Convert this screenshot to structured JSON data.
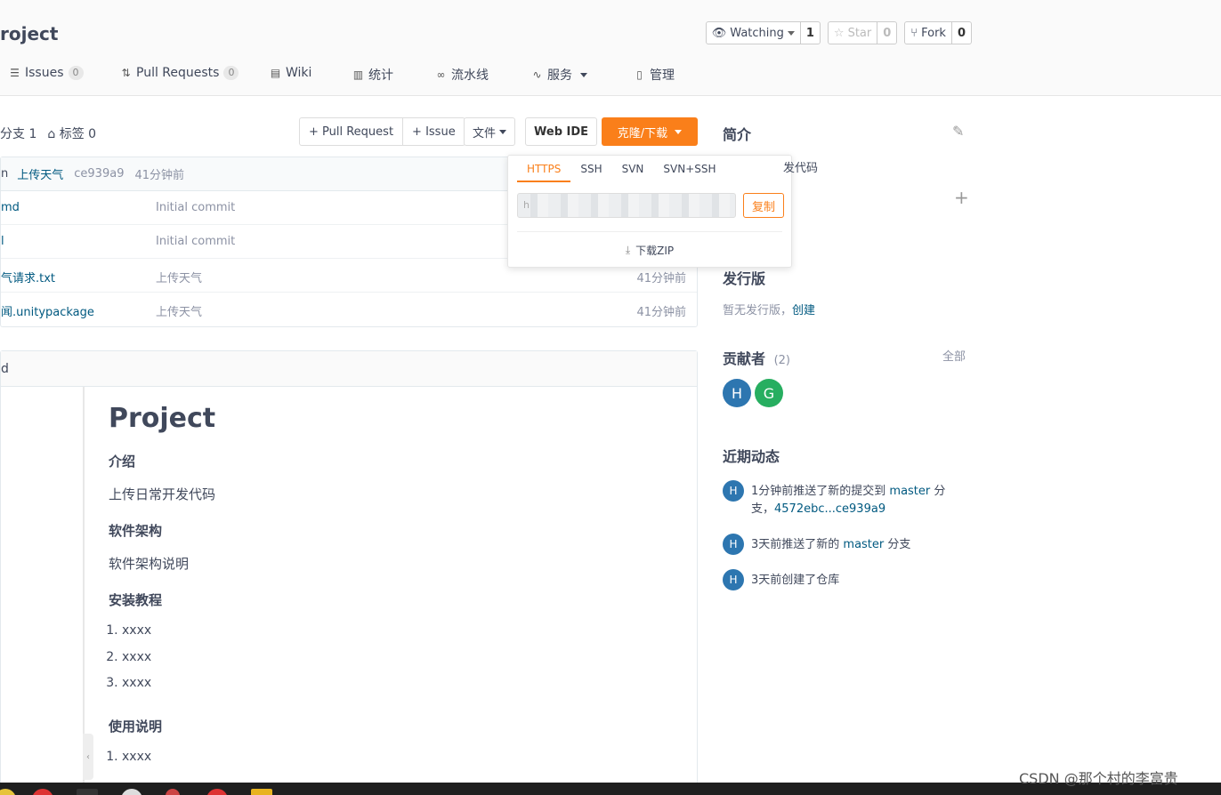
{
  "header": {
    "repo_title": "roject",
    "watching": {
      "label": "Watching",
      "count": "1"
    },
    "star": {
      "label": "Star",
      "count": "0"
    },
    "fork": {
      "label": "Fork",
      "count": "0"
    }
  },
  "tabs": [
    {
      "label": "Issues",
      "badge": "0",
      "icon": "issues-icon"
    },
    {
      "label": "Pull Requests",
      "badge": "0",
      "icon": "pull-request-icon"
    },
    {
      "label": "Wiki",
      "icon": "wiki-icon"
    },
    {
      "label": "统计",
      "icon": "stats-icon"
    },
    {
      "label": "流水线",
      "icon": "pipeline-icon"
    },
    {
      "label": "服务",
      "icon": "service-icon"
    },
    {
      "label": "管理",
      "icon": "manage-icon"
    }
  ],
  "branch": {
    "branches": "分支 1",
    "tags": "标签 0"
  },
  "actions": {
    "pull_request": "+ Pull Request",
    "issue": "+ Issue",
    "file": "文件",
    "web_ide": "Web IDE",
    "clone": "克隆/下载"
  },
  "latest_commit": {
    "author": "n",
    "message": "上传天气",
    "sha": "ce939a9",
    "time": "41分钟前"
  },
  "files": [
    {
      "name": "md",
      "message": "Initial commit",
      "time": ""
    },
    {
      "name": "l",
      "message": "Initial commit",
      "time": ""
    },
    {
      "name": "气请求.txt",
      "message": "上传天气",
      "time": "41分钟前"
    },
    {
      "name": "闻.unitypackage",
      "message": "上传天气",
      "time": "41分钟前"
    }
  ],
  "readme": {
    "header": "d",
    "title": "Project",
    "sections": {
      "intro_h": "介绍",
      "intro_p": "上传日常开发代码",
      "arch_h": "软件架构",
      "arch_p": "软件架构说明",
      "install_h": "安装教程",
      "install_items": [
        "xxxx",
        "xxxx",
        "xxxx"
      ],
      "usage_h": "使用说明",
      "usage_items": [
        "xxxx"
      ]
    }
  },
  "clone_dropdown": {
    "tabs": [
      "HTTPS",
      "SSH",
      "SVN",
      "SVN+SSH"
    ],
    "active_tab": "HTTPS",
    "url": "h",
    "copy": "复制",
    "download_zip": "下载ZIP"
  },
  "sidebar": {
    "intro_title": "简介",
    "intro_text": "发代码",
    "releases_title": "发行版",
    "releases_none": "暂无发行版，",
    "releases_create": "创建",
    "contributors_title": "贡献者",
    "contributors_count": "(2)",
    "contributors_all": "全部",
    "contributors": [
      {
        "initial": "H",
        "color": "#2d76b0"
      },
      {
        "initial": "G",
        "color": "#27ae60"
      }
    ],
    "activity_title": "近期动态",
    "activity": [
      {
        "avatar": "H",
        "pre": "1分钟前推送了新的提交到 ",
        "link": "master",
        "mid": " 分支，",
        "link2": "4572ebc...ce939a9"
      },
      {
        "avatar": "H",
        "pre": "3天前推送了新的 ",
        "link": "master",
        "mid": " 分支"
      },
      {
        "avatar": "H",
        "pre": "3天前创建了仓库"
      }
    ]
  },
  "watermark": "CSDN @那个村的李富贵",
  "colors": {
    "accent": "#fa7f1a",
    "link": "#005980",
    "avatar_blue": "#2d76b0",
    "avatar_green": "#27ae60"
  }
}
